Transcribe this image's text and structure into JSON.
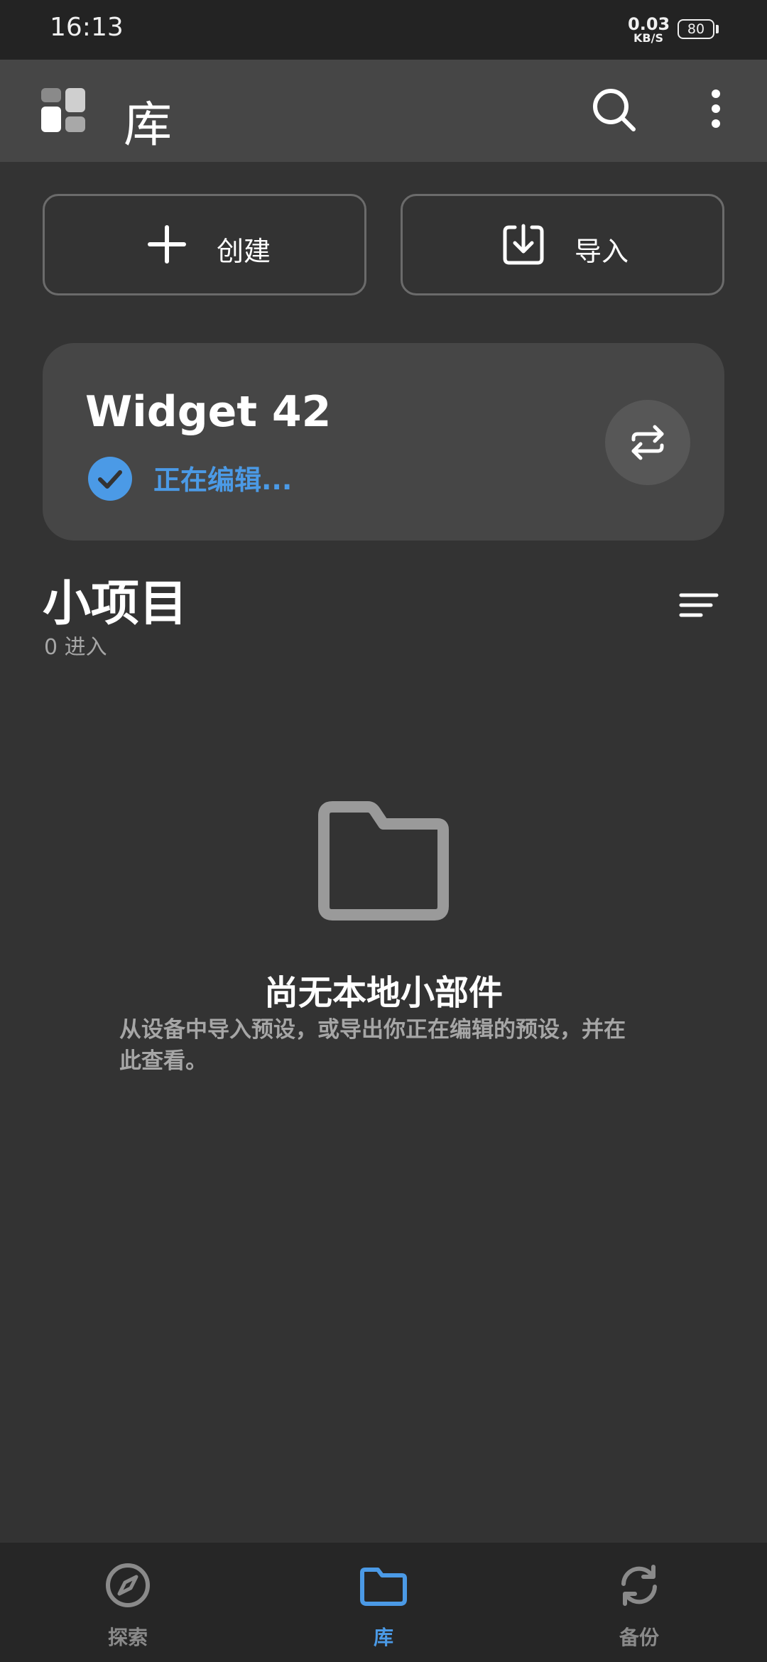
{
  "status_bar": {
    "time": "16:13",
    "net_speed_value": "0.03",
    "net_speed_unit": "KB/S",
    "battery": "80"
  },
  "app_bar": {
    "title": "库",
    "logo_icon": "widget-grid-logo",
    "search_icon": "search-icon",
    "more_icon": "more-vertical-icon"
  },
  "actions": {
    "create_label": "创建",
    "import_label": "导入"
  },
  "current_widget": {
    "name": "Widget 42",
    "status": "正在编辑..."
  },
  "section": {
    "title": "小项目",
    "count": "0 进入"
  },
  "empty_state": {
    "title": "尚无本地小部件",
    "description": "从设备中导入预设，或导出你正在编辑的预设，并在此查看。"
  },
  "bottom_nav": {
    "items": [
      {
        "label": "探索",
        "icon": "compass-icon",
        "active": false
      },
      {
        "label": "库",
        "icon": "folder-icon",
        "active": true
      },
      {
        "label": "备份",
        "icon": "sync-icon",
        "active": false
      }
    ]
  },
  "colors": {
    "background": "#333333",
    "surface": "#464646",
    "accent": "#4b9ae6",
    "muted_text": "#a6a6a6"
  }
}
